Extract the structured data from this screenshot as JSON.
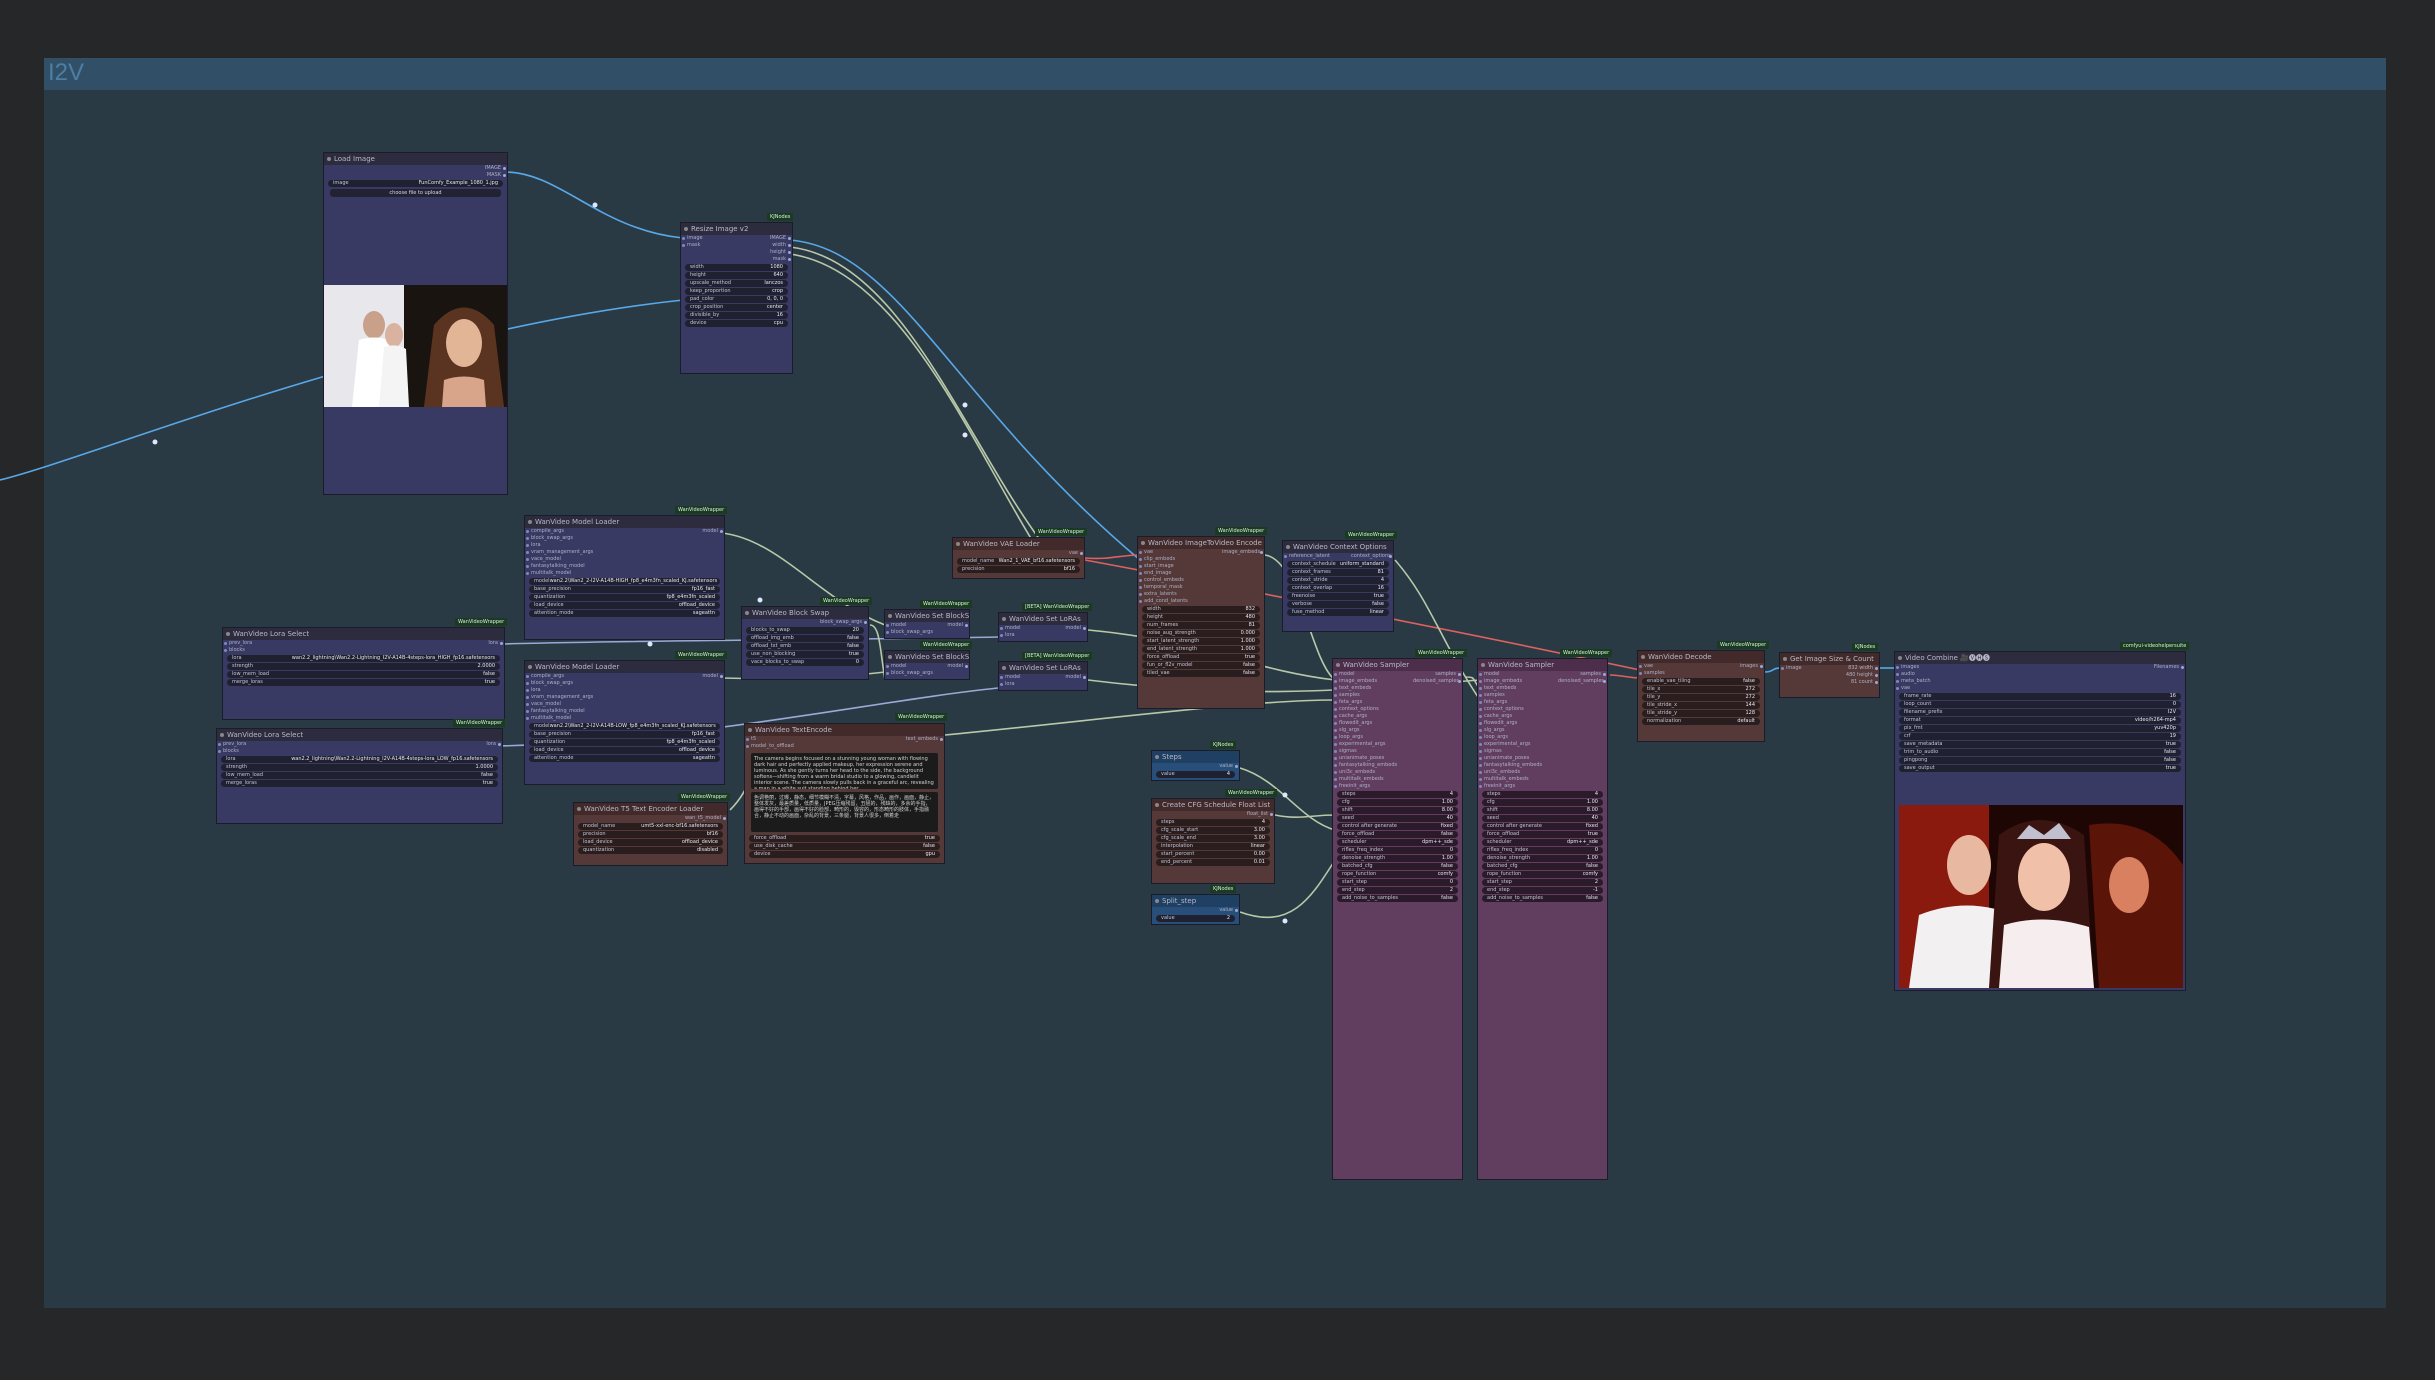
{
  "group": {
    "title": "I2V"
  },
  "colors": {
    "canvas": "#262729",
    "group": "#2a3a44",
    "group_title": "#315068",
    "node": "#393a63",
    "brown_node": "#553838",
    "purple_node": "#613e60",
    "blue_node": "#274f7a",
    "badge": "#1b3a22",
    "link_image": "#58a8e8",
    "link_model": "#b8c8a8",
    "link_red": "#e06060"
  },
  "nodes": {
    "load_image": {
      "title": "Load Image",
      "outputs": [
        "IMAGE",
        "MASK"
      ],
      "widget": {
        "label": "image",
        "value": "FunComfy_Example_1080_1.jpg"
      },
      "button": "choose file to upload"
    },
    "resize": {
      "title": "Resize Image v2",
      "badge": "KJNodes",
      "inputs": [
        "image",
        "mask"
      ],
      "outputs": [
        "IMAGE",
        "width",
        "height",
        "mask"
      ],
      "widgets": [
        [
          "width",
          "1080"
        ],
        [
          "height",
          "640"
        ],
        [
          "upscale_method",
          "lanczos"
        ],
        [
          "keep_proportion",
          "crop"
        ],
        [
          "pad_color",
          "0, 0, 0"
        ],
        [
          "crop_position",
          "center"
        ],
        [
          "divisible_by",
          "16"
        ],
        [
          "device",
          "cpu"
        ]
      ]
    },
    "model_loader_1": {
      "title": "WanVideo Model Loader",
      "badge": "WanVideoWrapper",
      "inputs": [
        "compile_args",
        "block_swap_args",
        "lora",
        "vram_management_args",
        "vace_model",
        "fantasytalking_model",
        "multitalk_model"
      ],
      "output": "model",
      "widgets": [
        [
          "model",
          "wan2.2\\Wan2_2-I2V-A14B-HIGH_fp8_e4m3fn_scaled_KJ.safetensors"
        ],
        [
          "base_precision",
          "fp16_fast"
        ],
        [
          "quantization",
          "fp8_e4m3fn_scaled"
        ],
        [
          "load_device",
          "offload_device"
        ],
        [
          "attention_mode",
          "sageattn"
        ]
      ]
    },
    "model_loader_2": {
      "title": "WanVideo Model Loader",
      "badge": "WanVideoWrapper",
      "inputs": [
        "compile_args",
        "block_swap_args",
        "lora",
        "vram_management_args",
        "vace_model",
        "fantasytalking_model",
        "multitalk_model"
      ],
      "output": "model",
      "widgets": [
        [
          "model",
          "wan2.2\\Wan2_2-I2V-A14B-LOW_fp8_e4m3fn_scaled_KJ.safetensors"
        ],
        [
          "base_precision",
          "fp16_fast"
        ],
        [
          "quantization",
          "fp8_e4m3fn_scaled"
        ],
        [
          "load_device",
          "offload_device"
        ],
        [
          "attention_mode",
          "sageattn"
        ]
      ]
    },
    "lora_1": {
      "title": "WanVideo Lora Select",
      "badge": "WanVideoWrapper",
      "inputs": [
        "prev_lora",
        "blocks"
      ],
      "output": "lora",
      "widgets": [
        [
          "lora",
          "wan2.2_lightning\\Wan2.2-Lightning_I2V-A14B-4steps-lora_HIGH_fp16.safetensors"
        ],
        [
          "strength",
          "2.0000"
        ],
        [
          "low_mem_load",
          "false"
        ],
        [
          "merge_loras",
          "true"
        ]
      ]
    },
    "lora_2": {
      "title": "WanVideo Lora Select",
      "badge": "WanVideoWrapper",
      "inputs": [
        "prev_lora",
        "blocks"
      ],
      "output": "lora",
      "widgets": [
        [
          "lora",
          "wan2.2_lightning\\Wan2.2-Lightning_I2V-A14B-4steps-lora_LOW_fp16.safetensors"
        ],
        [
          "strength",
          "1.0000"
        ],
        [
          "low_mem_load",
          "false"
        ],
        [
          "merge_loras",
          "true"
        ]
      ]
    },
    "block_swap": {
      "title": "WanVideo Block Swap",
      "badge": "WanVideoWrapper",
      "output": "block_swap_args",
      "widgets": [
        [
          "blocks_to_swap",
          "20"
        ],
        [
          "offload_img_emb",
          "false"
        ],
        [
          "offload_txt_emb",
          "false"
        ],
        [
          "use_non_blocking",
          "true"
        ],
        [
          "vace_blocks_to_swap",
          "0"
        ]
      ]
    },
    "set_block_swap_1": {
      "title": "WanVideo Set BlockSwap",
      "badge": "WanVideoWrapper",
      "inputs": [
        "model",
        "block_swap_args"
      ],
      "output": "model"
    },
    "set_block_swap_2": {
      "title": "WanVideo Set BlockSwap",
      "badge": "WanVideoWrapper",
      "inputs": [
        "model",
        "block_swap_args"
      ],
      "output": "model"
    },
    "set_lora_1": {
      "title": "WanVideo Set LoRAs",
      "badge": "[BETA] WanVideoWrapper",
      "inputs": [
        "model",
        "lora"
      ],
      "output": "model"
    },
    "set_lora_2": {
      "title": "WanVideo Set LoRAs",
      "badge": "[BETA] WanVideoWrapper",
      "inputs": [
        "model",
        "lora"
      ],
      "output": "model"
    },
    "vae_loader": {
      "title": "WanVideo VAE Loader",
      "badge": "WanVideoWrapper",
      "output": "vae",
      "widgets": [
        [
          "model_name",
          "Wan2_1_VAE_bf16.safetensors"
        ],
        [
          "precision",
          "bf16"
        ]
      ]
    },
    "t5_loader": {
      "title": "WanVideo T5 Text Encoder Loader",
      "badge": "WanVideoWrapper",
      "output": "wan_t5_model",
      "widgets": [
        [
          "model_name",
          "umt5-xxl-enc-bf16.safetensors"
        ],
        [
          "precision",
          "bf16"
        ],
        [
          "load_device",
          "offload_device"
        ],
        [
          "quantization",
          "disabled"
        ]
      ]
    },
    "text_encode": {
      "title": "WanVideo TextEncode",
      "badge": "WanVideoWrapper",
      "inputs": [
        "t5",
        "model_to_offload"
      ],
      "output": "text_embeds",
      "positive": "The camera begins focused on a stunning young woman with flowing dark hair and perfectly applied makeup, her expression serene and luminous. As she gently turns her head to the side, the background softens—shifting from a warm bridal studio to a glowing, candlelit interior scene. The camera slowly pulls back in a graceful arc, revealing a man in a white suit standing behind her...",
      "negative": "色调艳丽，过曝，静态，细节模糊不清，字幕，风格，作品，画作，画面，静止，整体发灰，最差质量，低质量，JPEG压缩残留，丑陋的，残缺的，多余的手指，画得不好的手部，画得不好的脸部，畸形的，毁容的，形态畸形的肢体，手指融合，静止不动的画面，杂乱的背景，三条腿，背景人很多，倒着走",
      "widgets": [
        [
          "force_offload",
          "true"
        ],
        [
          "use_disk_cache",
          "false"
        ],
        [
          "device",
          "gpu"
        ]
      ]
    },
    "img2vid": {
      "title": "WanVideo ImageToVideo Encode",
      "badge": "WanVideoWrapper",
      "inputs": [
        "vae",
        "clip_embeds",
        "start_image",
        "end_image",
        "control_embeds",
        "temporal_mask",
        "extra_latents",
        "add_cond_latents"
      ],
      "output": "image_embeds",
      "widgets": [
        [
          "width",
          "832"
        ],
        [
          "height",
          "480"
        ],
        [
          "num_frames",
          "81"
        ],
        [
          "noise_aug_strength",
          "0.000"
        ],
        [
          "start_latent_strength",
          "1.000"
        ],
        [
          "end_latent_strength",
          "1.000"
        ],
        [
          "force_offload",
          "true"
        ],
        [
          "fun_or_fl2v_model",
          "false"
        ],
        [
          "tiled_vae",
          "false"
        ]
      ]
    },
    "context": {
      "title": "WanVideo Context Options",
      "badge": "WanVideoWrapper",
      "inputs": [
        "reference_latent"
      ],
      "output": "context_options",
      "widgets": [
        [
          "context_schedule",
          "uniform_standard"
        ],
        [
          "context_frames",
          "81"
        ],
        [
          "context_stride",
          "4"
        ],
        [
          "context_overlap",
          "16"
        ],
        [
          "freenoise",
          "true"
        ],
        [
          "verbose",
          "false"
        ],
        [
          "fuse_method",
          "linear"
        ]
      ]
    },
    "steps": {
      "title": "Steps",
      "badge": "KJNodes",
      "output": "value",
      "widget": [
        "value",
        "4"
      ]
    },
    "split_step": {
      "title": "Split_step",
      "badge": "KJNodes",
      "output": "value",
      "widget": [
        "value",
        "2"
      ]
    },
    "cfg": {
      "title": "Create CFG Schedule Float List",
      "badge": "WanVideoWrapper",
      "output": "float_list",
      "widgets": [
        [
          "steps",
          "4"
        ],
        [
          "cfg_scale_start",
          "3.00"
        ],
        [
          "cfg_scale_end",
          "3.00"
        ],
        [
          "interpolation",
          "linear"
        ],
        [
          "start_percent",
          "0.00"
        ],
        [
          "end_percent",
          "0.01"
        ]
      ]
    },
    "sampler_1": {
      "title": "WanVideo Sampler",
      "badge": "WanVideoWrapper",
      "inputs": [
        "model",
        "image_embeds",
        "text_embeds",
        "samples",
        "feta_args",
        "context_options",
        "cache_args",
        "flowedit_args",
        "slg_args",
        "loop_args",
        "experimental_args",
        "sigmas",
        "unianimate_poses",
        "fantasytalking_embeds",
        "uni3c_embeds",
        "multitalk_embeds",
        "freeinit_args"
      ],
      "outputs": [
        "samples",
        "denoised_samples"
      ],
      "widgets": [
        [
          "steps",
          "4"
        ],
        [
          "cfg",
          "1.00"
        ],
        [
          "shift",
          "8.00"
        ],
        [
          "seed",
          "40"
        ],
        [
          "control after generate",
          "fixed"
        ],
        [
          "force_offload",
          "false"
        ],
        [
          "scheduler",
          "dpm++_sde"
        ],
        [
          "riflex_freq_index",
          "0"
        ],
        [
          "denoise_strength",
          "1.00"
        ],
        [
          "batched_cfg",
          "false"
        ],
        [
          "rope_function",
          "comfy"
        ],
        [
          "start_step",
          "0"
        ],
        [
          "end_step",
          "2"
        ],
        [
          "add_noise_to_samples",
          "false"
        ]
      ]
    },
    "sampler_2": {
      "title": "WanVideo Sampler",
      "badge": "WanVideoWrapper",
      "inputs": [
        "model",
        "image_embeds",
        "text_embeds",
        "samples",
        "feta_args",
        "context_options",
        "cache_args",
        "flowedit_args",
        "slg_args",
        "loop_args",
        "experimental_args",
        "sigmas",
        "unianimate_poses",
        "fantasytalking_embeds",
        "uni3c_embeds",
        "multitalk_embeds",
        "freeinit_args"
      ],
      "outputs": [
        "samples",
        "denoised_samples"
      ],
      "widgets": [
        [
          "steps",
          "4"
        ],
        [
          "cfg",
          "1.00"
        ],
        [
          "shift",
          "8.00"
        ],
        [
          "seed",
          "40"
        ],
        [
          "control after generate",
          "fixed"
        ],
        [
          "force_offload",
          "true"
        ],
        [
          "scheduler",
          "dpm++_sde"
        ],
        [
          "riflex_freq_index",
          "0"
        ],
        [
          "denoise_strength",
          "1.00"
        ],
        [
          "batched_cfg",
          "false"
        ],
        [
          "rope_function",
          "comfy"
        ],
        [
          "start_step",
          "2"
        ],
        [
          "end_step",
          "-1"
        ],
        [
          "add_noise_to_samples",
          "false"
        ]
      ]
    },
    "decode": {
      "title": "WanVideo Decode",
      "badge": "WanVideoWrapper",
      "inputs": [
        "vae",
        "samples"
      ],
      "output": "images",
      "widgets": [
        [
          "enable_vae_tiling",
          "false"
        ],
        [
          "tile_x",
          "272"
        ],
        [
          "tile_y",
          "272"
        ],
        [
          "tile_stride_x",
          "144"
        ],
        [
          "tile_stride_y",
          "128"
        ],
        [
          "normalization",
          "default"
        ]
      ]
    },
    "size_count": {
      "title": "Get Image Size & Count",
      "badge": "KJNodes",
      "inputs": [
        "image"
      ],
      "outputs": [
        "image",
        "width",
        "height",
        "count"
      ],
      "values": [
        "832 width",
        "480 height",
        "81 count"
      ]
    },
    "video_combine": {
      "title": "Video Combine 🎥🅥🅗🅢",
      "badge": "comfyui-videohelpersuite",
      "inputs": [
        "images",
        "audio",
        "meta_batch",
        "vae"
      ],
      "output": "Filenames",
      "widgets": [
        [
          "frame_rate",
          "16"
        ],
        [
          "loop_count",
          "0"
        ],
        [
          "filename_prefix",
          "I2V"
        ],
        [
          "format",
          "video/h264-mp4"
        ],
        [
          "pix_fmt",
          "yuv420p"
        ],
        [
          "crf",
          "19"
        ],
        [
          "save_metadata",
          "true"
        ],
        [
          "trim_to_audio",
          "false"
        ],
        [
          "pingpong",
          "false"
        ],
        [
          "save_output",
          "true"
        ]
      ]
    }
  }
}
